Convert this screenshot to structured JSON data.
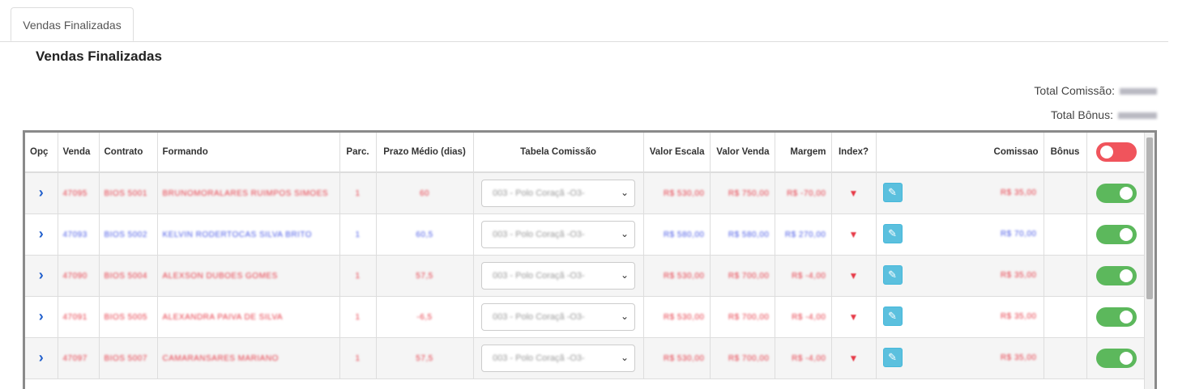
{
  "tab": {
    "label": "Vendas Finalizadas"
  },
  "page": {
    "title": "Vendas Finalizadas"
  },
  "totals": {
    "comissao_label": "Total Comissão:",
    "bonus_label": "Total Bônus:"
  },
  "table": {
    "headers": {
      "opc": "Opç",
      "venda": "Venda",
      "contrato": "Contrato",
      "formando": "Formando",
      "parc": "Parc.",
      "prazo": "Prazo Médio (dias)",
      "tabela": "Tabela Comissão",
      "valor_escala": "Valor Escala",
      "valor_venda": "Valor Venda",
      "margem": "Margem",
      "index": "Index?",
      "comissao": "Comissao",
      "bonus": "Bônus"
    },
    "rows": [
      {
        "venda": "47095",
        "contrato": "BIOS 5001",
        "formando": "BRUNOMORALARES RUIMPOS SIMOES",
        "parc": "1",
        "prazo": "60",
        "tabela": "003 - Polo Coraçã -O3-",
        "valor_escala": "R$ 530,00",
        "valor_venda": "R$ 750,00",
        "margem": "R$ -70,00",
        "comissao": "R$ 35,00",
        "color": "red"
      },
      {
        "venda": "47093",
        "contrato": "BIOS 5002",
        "formando": "KELVIN RODERTOCAS SILVA BRITO",
        "parc": "1",
        "prazo": "60,5",
        "tabela": "003 - Polo Coraçã -O3-",
        "valor_escala": "R$ 580,00",
        "valor_venda": "R$ 580,00",
        "margem": "R$ 270,00",
        "comissao": "R$ 70,00",
        "color": "blue"
      },
      {
        "venda": "47090",
        "contrato": "BIOS 5004",
        "formando": "ALEXSON DUBOES GOMES",
        "parc": "1",
        "prazo": "57,5",
        "tabela": "003 - Polo Coraçã -O3-",
        "valor_escala": "R$ 530,00",
        "valor_venda": "R$ 700,00",
        "margem": "R$ -4,00",
        "comissao": "R$ 35,00",
        "color": "red"
      },
      {
        "venda": "47091",
        "contrato": "BIOS 5005",
        "formando": "ALEXANDRA PAIVA DE SILVA",
        "parc": "1",
        "prazo": "-6,5",
        "tabela": "003 - Polo Coraçã -O3-",
        "valor_escala": "R$ 530,00",
        "valor_venda": "R$ 700,00",
        "margem": "R$ -4,00",
        "comissao": "R$ 35,00",
        "color": "red"
      },
      {
        "venda": "47097",
        "contrato": "BIOS 5007",
        "formando": "CAMARANSARES MARIANO",
        "parc": "1",
        "prazo": "57,5",
        "tabela": "003 - Polo Coraçã -O3-",
        "valor_escala": "R$ 530,00",
        "valor_venda": "R$ 700,00",
        "margem": "R$ -4,00",
        "comissao": "R$ 35,00",
        "color": "red"
      }
    ]
  },
  "colors": {
    "accent_blue": "#1f5ecc",
    "toggle_on": "#5cb85c",
    "toggle_off": "#f0545c",
    "edit_button": "#5bc0de"
  },
  "icons": {
    "expand": "chevron-right-icon",
    "edit": "pencil-icon",
    "index": "flag-icon"
  }
}
